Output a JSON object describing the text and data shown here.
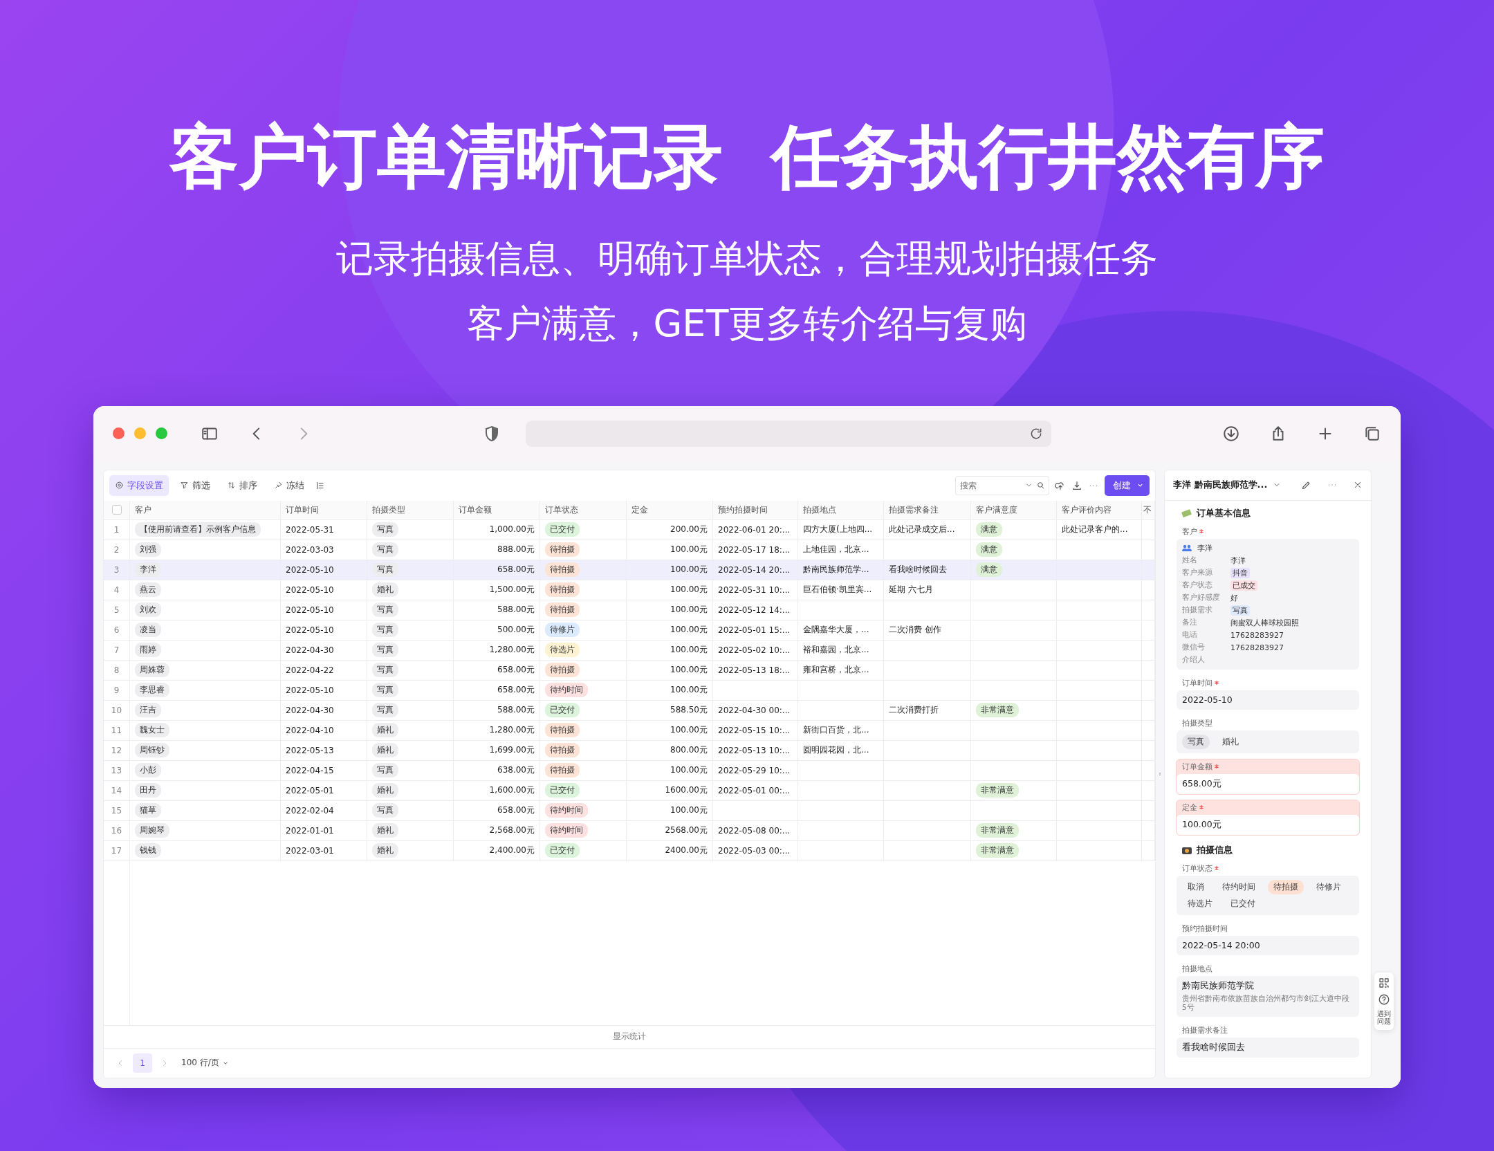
{
  "headline": "客户订单清晰记录  任务执行井然有序",
  "subtitle_lines": [
    "记录拍摄信息、明确订单状态，合理规划拍摄任务",
    "客户满意，GET更多转介绍与复购"
  ],
  "toolbar": {
    "items": [
      {
        "label": "字段设置",
        "selected": true
      },
      {
        "label": "筛选",
        "selected": false
      },
      {
        "label": "排序",
        "selected": false
      },
      {
        "label": "冻结",
        "selected": false
      }
    ],
    "search": {
      "placeholder": "搜索"
    },
    "create_button": "创建"
  },
  "table": {
    "columns": [
      "客户",
      "订单时间",
      "拍摄类型",
      "订单金额",
      "订单状态",
      "定金",
      "预约拍摄时间",
      "拍摄地点",
      "拍摄需求备注",
      "客户满意度",
      "客户评价内容",
      "不"
    ],
    "select_all_checked": false,
    "rows": [
      {
        "index": "1",
        "customer": "【使用前请查看】示例客户信息",
        "order_date": "2022-05-31",
        "type": "写真",
        "amount": "1,000.00元",
        "status": {
          "text": "已交付",
          "color": "#dcf3dc"
        },
        "deposit": "200.00元",
        "appointment": "2022-06-01 20:...",
        "location": "四方大厦(上地四...",
        "notes": "此处记录成交后...",
        "satisfaction": "满意",
        "review": "此处记录客户的...",
        "selected": false
      },
      {
        "index": "2",
        "customer": "刘强",
        "order_date": "2022-03-03",
        "type": "写真",
        "amount": "888.00元",
        "status": {
          "text": "待拍摄",
          "color": "#fde3d6"
        },
        "deposit": "100.00元",
        "appointment": "2022-05-17 18:...",
        "location": "上地佳园，北京...",
        "notes": "",
        "satisfaction": "满意",
        "review": "",
        "selected": false
      },
      {
        "index": "3",
        "customer": "李洋",
        "order_date": "2022-05-10",
        "type": "写真",
        "amount": "658.00元",
        "status": {
          "text": "待拍摄",
          "color": "#fde3d6"
        },
        "deposit": "100.00元",
        "appointment": "2022-05-14 20:...",
        "location": "黔南民族师范学...",
        "notes": "看我啥时候回去",
        "satisfaction": "满意",
        "review": "",
        "selected": true
      },
      {
        "index": "4",
        "customer": "燕云",
        "order_date": "2022-05-10",
        "type": "婚礼",
        "amount": "1,500.00元",
        "status": {
          "text": "待拍摄",
          "color": "#fde3d6"
        },
        "deposit": "100.00元",
        "appointment": "2022-05-31 10:...",
        "location": "巨石伯顿·凯里宾...",
        "notes": "延期 六七月",
        "satisfaction": "",
        "review": "",
        "selected": false
      },
      {
        "index": "5",
        "customer": "刘欢",
        "order_date": "2022-05-10",
        "type": "写真",
        "amount": "588.00元",
        "status": {
          "text": "待拍摄",
          "color": "#fde3d6"
        },
        "deposit": "100.00元",
        "appointment": "2022-05-12 14:...",
        "location": "",
        "notes": "",
        "satisfaction": "",
        "review": "",
        "selected": false
      },
      {
        "index": "6",
        "customer": "凌当",
        "order_date": "2022-05-10",
        "type": "写真",
        "amount": "500.00元",
        "status": {
          "text": "待修片",
          "color": "#dbeafd"
        },
        "deposit": "100.00元",
        "appointment": "2022-05-01 15:...",
        "location": "金隅嘉华大厦，...",
        "notes": "二次消费 创作",
        "satisfaction": "",
        "review": "",
        "selected": false
      },
      {
        "index": "7",
        "customer": "雨婷",
        "order_date": "2022-04-30",
        "type": "写真",
        "amount": "1,280.00元",
        "status": {
          "text": "待选片",
          "color": "#fdf3d2"
        },
        "deposit": "100.00元",
        "appointment": "2022-05-02 10:...",
        "location": "裕和嘉园，北京...",
        "notes": "",
        "satisfaction": "",
        "review": "",
        "selected": false
      },
      {
        "index": "8",
        "customer": "周姝蓉",
        "order_date": "2022-04-22",
        "type": "写真",
        "amount": "658.00元",
        "status": {
          "text": "待拍摄",
          "color": "#fde3d6"
        },
        "deposit": "100.00元",
        "appointment": "2022-05-13 18:...",
        "location": "雍和宫桥，北京...",
        "notes": "",
        "satisfaction": "",
        "review": "",
        "selected": false
      },
      {
        "index": "9",
        "customer": "李思睿",
        "order_date": "2022-05-10",
        "type": "写真",
        "amount": "658.00元",
        "status": {
          "text": "待约时间",
          "color": "#fde0e0"
        },
        "deposit": "100.00元",
        "appointment": "",
        "location": "",
        "notes": "",
        "satisfaction": "",
        "review": "",
        "selected": false
      },
      {
        "index": "10",
        "customer": "汪吉",
        "order_date": "2022-04-30",
        "type": "写真",
        "amount": "588.00元",
        "status": {
          "text": "已交付",
          "color": "#dcf3dc"
        },
        "deposit": "588.50元",
        "appointment": "2022-04-30 00:...",
        "location": "",
        "notes": "二次消费打折",
        "satisfaction": "非常满意",
        "review": "",
        "selected": false
      },
      {
        "index": "11",
        "customer": "魏女士",
        "order_date": "2022-04-10",
        "type": "婚礼",
        "amount": "1,280.00元",
        "status": {
          "text": "待拍摄",
          "color": "#fde3d6"
        },
        "deposit": "100.00元",
        "appointment": "2022-05-15 10:...",
        "location": "新街口百货，北...",
        "notes": "",
        "satisfaction": "",
        "review": "",
        "selected": false
      },
      {
        "index": "12",
        "customer": "周钰钞",
        "order_date": "2022-05-13",
        "type": "婚礼",
        "amount": "1,699.00元",
        "status": {
          "text": "待拍摄",
          "color": "#fde3d6"
        },
        "deposit": "800.00元",
        "appointment": "2022-05-13 10:...",
        "location": "圆明园花园，北...",
        "notes": "",
        "satisfaction": "",
        "review": "",
        "selected": false
      },
      {
        "index": "13",
        "customer": "小彭",
        "order_date": "2022-04-15",
        "type": "写真",
        "amount": "638.00元",
        "status": {
          "text": "待拍摄",
          "color": "#fde3d6"
        },
        "deposit": "100.00元",
        "appointment": "2022-05-29 10:...",
        "location": "",
        "notes": "",
        "satisfaction": "",
        "review": "",
        "selected": false
      },
      {
        "index": "14",
        "customer": "田丹",
        "order_date": "2022-05-01",
        "type": "婚礼",
        "amount": "1,600.00元",
        "status": {
          "text": "已交付",
          "color": "#dcf3dc"
        },
        "deposit": "1600.00元",
        "appointment": "2022-05-01 00:...",
        "location": "",
        "notes": "",
        "satisfaction": "非常满意",
        "review": "",
        "selected": false
      },
      {
        "index": "15",
        "customer": "猫草",
        "order_date": "2022-02-04",
        "type": "写真",
        "amount": "658.00元",
        "status": {
          "text": "待约时间",
          "color": "#fde0e0"
        },
        "deposit": "100.00元",
        "appointment": "",
        "location": "",
        "notes": "",
        "satisfaction": "",
        "review": "",
        "selected": false
      },
      {
        "index": "16",
        "customer": "周婉琴",
        "order_date": "2022-01-01",
        "type": "婚礼",
        "amount": "2,568.00元",
        "status": {
          "text": "待约时间",
          "color": "#fde0e0"
        },
        "deposit": "2568.00元",
        "appointment": "2022-05-08 00:...",
        "location": "",
        "notes": "",
        "satisfaction": "非常满意",
        "review": "",
        "selected": false
      },
      {
        "index": "17",
        "customer": "钱钱",
        "order_date": "2022-03-01",
        "type": "婚礼",
        "amount": "2,400.00元",
        "status": {
          "text": "已交付",
          "color": "#dcf3dc"
        },
        "deposit": "2400.00元",
        "appointment": "2022-05-03 00:...",
        "location": "",
        "notes": "",
        "satisfaction": "非常满意",
        "review": "",
        "selected": false
      }
    ],
    "footer": "显示统计"
  },
  "pagination": {
    "pages": [
      {
        "label": "1",
        "selected": true
      }
    ],
    "page_size": "100 行/页"
  },
  "panel": {
    "title": "李洋 黔南民族师范学...",
    "sections": [
      {
        "title": "订单基本信息",
        "fields": [
          {
            "kind": "customer",
            "label": "客户",
            "required": true,
            "highlighted": false,
            "name": "李洋",
            "details": [
              {
                "label": "姓名",
                "value": "李洋"
              },
              {
                "label": "客户来源",
                "value": "抖音",
                "color": "#e6e0fb"
              },
              {
                "label": "客户状态",
                "value": "已成交",
                "color": "#fde0e4"
              },
              {
                "label": "客户好感度",
                "value": "好"
              },
              {
                "label": "拍摄需求",
                "value": "写真",
                "color": "#dfeafd"
              },
              {
                "label": "备注",
                "value": "闺蜜双人棒球校园照"
              },
              {
                "label": "电话",
                "value": "17628283927"
              },
              {
                "label": "微信号",
                "value": "17628283927"
              },
              {
                "label": "介绍人"
              }
            ]
          },
          {
            "kind": "text",
            "label": "订单时间",
            "required": true,
            "highlighted": false,
            "value": "2022-05-10"
          },
          {
            "kind": "options",
            "label": "拍摄类型",
            "required": false,
            "highlighted": false,
            "options": [
              {
                "label": "写真",
                "selected": true
              },
              {
                "label": "婚礼",
                "selected": false
              }
            ]
          },
          {
            "kind": "text",
            "label": "订单金额",
            "required": true,
            "highlighted": true,
            "value": "658.00元"
          },
          {
            "kind": "text",
            "label": "定金",
            "required": true,
            "highlighted": true,
            "value": "100.00元"
          }
        ]
      },
      {
        "title": "拍摄信息",
        "fields": [
          {
            "kind": "options",
            "label": "订单状态",
            "required": true,
            "highlighted": false,
            "options": [
              {
                "label": "取消",
                "selected": false
              },
              {
                "label": "待约时间",
                "selected": false
              },
              {
                "label": "待拍摄",
                "selected": true
              },
              {
                "label": "待修片",
                "selected": false
              },
              {
                "label": "待选片",
                "selected": false
              },
              {
                "label": "已交付",
                "selected": false
              }
            ]
          },
          {
            "kind": "text",
            "label": "预约拍摄时间",
            "required": false,
            "highlighted": false,
            "value": "2022-05-14 20:00"
          },
          {
            "kind": "place",
            "label": "拍摄地点",
            "required": false,
            "highlighted": false,
            "value": "黔南民族师范学院",
            "address": "贵州省黔南布依族苗族自治州都匀市剑江大道中段5号"
          },
          {
            "kind": "text",
            "label": "拍摄需求备注",
            "required": false,
            "highlighted": false,
            "value": "看我啥时候回去"
          }
        ]
      }
    ]
  },
  "help_widget": {
    "label": "遇到问题"
  }
}
